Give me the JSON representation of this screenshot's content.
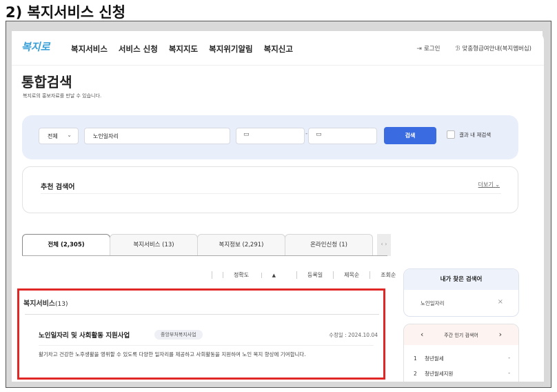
{
  "slide_title": "2) 복지서비스 신청",
  "header": {
    "logo": "복지로",
    "nav": [
      "복지서비스",
      "서비스 신청",
      "복지지도",
      "복지위기알림",
      "복지신고"
    ],
    "login": "로그인",
    "guide": "맞춤형급여안내(복지멤버십)"
  },
  "page": {
    "title": "통합검색",
    "subtitle": "복지로의 홍보자료를 만날 수 있습니다."
  },
  "search": {
    "scope": "전체",
    "keyword": "노인일자리",
    "date_sep": "-",
    "button": "검색",
    "within_results": "결과 내 재검색"
  },
  "recommend": {
    "title": "추천 검색어",
    "more": "더보기"
  },
  "tabs": [
    "전체 (2,305)",
    "복지서비스 (13)",
    "복지정보 (2,291)",
    "온라인신청 (1)"
  ],
  "sort": {
    "options": [
      "정확도",
      "등록일",
      "제목순",
      "조회순"
    ],
    "active_arrow": "▲"
  },
  "results": {
    "section_title": "복지서비스",
    "section_count": "(13)",
    "card": {
      "name": "노인일자리 및 사회활동 지원사업",
      "badge": "중앙부처복지사업",
      "date": "수정일 : 2024.10.04",
      "desc": "활기차고 건강한 노후생활을 영위할 수 있도록 다양한 일자리를 제공하고 사회활동을 지원하여 노인 복지 향상에 기여합니다."
    }
  },
  "my_searches": {
    "title": "내가 찾은 검색어",
    "item": "노인일자리"
  },
  "popular": {
    "title": "주간 인기 검색어",
    "rows": [
      {
        "rank": "1",
        "term": "청년월세",
        "change": "-"
      },
      {
        "rank": "2",
        "term": "청년월세지원",
        "change": "-"
      }
    ]
  },
  "colors": {
    "accent": "#3b6be0",
    "highlight": "#e12626"
  }
}
